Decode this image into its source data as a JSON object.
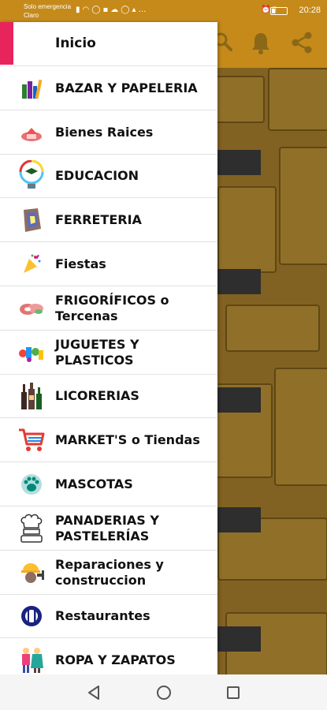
{
  "status_bar": {
    "line1": "Solo emergencia",
    "line2": "Claro",
    "time": "20:28",
    "battery_fraction": 0.2
  },
  "drawer": {
    "header_label": "Inicio",
    "items": [
      {
        "label": "BAZAR Y PAPELERIA",
        "icon": "stationery-icon"
      },
      {
        "label": "Bienes Raices",
        "icon": "real-estate-icon"
      },
      {
        "label": "EDUCACION",
        "icon": "education-icon"
      },
      {
        "label": "FERRETERIA",
        "icon": "hardware-icon"
      },
      {
        "label": "Fiestas",
        "icon": "party-icon"
      },
      {
        "label": "FRIGORÍFICOS o Tercenas",
        "icon": "meat-icon"
      },
      {
        "label": "JUGUETES Y PLASTICOS",
        "icon": "toys-icon"
      },
      {
        "label": "LICORERIAS",
        "icon": "liquor-icon"
      },
      {
        "label": "MARKET'S o Tiendas",
        "icon": "shopping-cart-icon"
      },
      {
        "label": "MASCOTAS",
        "icon": "paw-icon"
      },
      {
        "label": "PANADERIAS Y PASTELERÍAS",
        "icon": "chef-icon"
      },
      {
        "label": "Reparaciones y construccion",
        "icon": "construction-icon"
      },
      {
        "label": "Restaurantes",
        "icon": "restaurant-icon"
      },
      {
        "label": "ROPA Y ZAPATOS",
        "icon": "clothing-icon"
      }
    ]
  },
  "toolbar": {
    "icons": [
      "search-icon",
      "bell-icon",
      "share-icon"
    ]
  },
  "navbar": {
    "buttons": [
      "back-button",
      "home-button",
      "recents-button"
    ]
  },
  "colors": {
    "status_bar": "#c58a1a",
    "accent_pink": "#e8245c",
    "brick_wall": "#826222"
  }
}
